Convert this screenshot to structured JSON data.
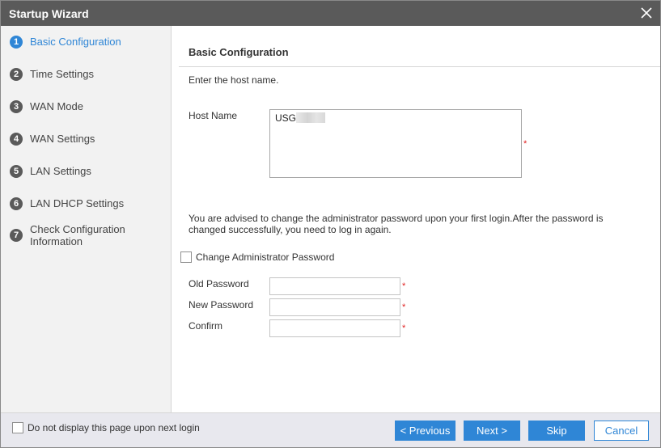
{
  "window": {
    "title": "Startup Wizard",
    "close_icon": "close-icon"
  },
  "sidebar": {
    "steps": [
      {
        "num": "1",
        "label": "Basic Configuration",
        "active": true
      },
      {
        "num": "2",
        "label": "Time Settings"
      },
      {
        "num": "3",
        "label": "WAN Mode"
      },
      {
        "num": "4",
        "label": "WAN Settings"
      },
      {
        "num": "5",
        "label": "LAN Settings"
      },
      {
        "num": "6",
        "label": "LAN DHCP Settings"
      },
      {
        "num": "7",
        "label": "Check Configuration Information"
      }
    ]
  },
  "main": {
    "section_title": "Basic Configuration",
    "intro": "Enter the host name.",
    "host_name": {
      "label": "Host Name",
      "value": "USG"
    },
    "required_mark": "*",
    "advice": "You are advised to change the administrator password upon your first login.After the password is changed successfully, you need to log in again.",
    "change_password": {
      "label": "Change Administrator Password",
      "checked": false
    },
    "old_password": {
      "label": "Old Password",
      "value": ""
    },
    "new_password": {
      "label": "New Password",
      "value": ""
    },
    "confirm": {
      "label": "Confirm",
      "value": ""
    }
  },
  "footer": {
    "dont_show_label": "Do not display this page upon next login",
    "previous": "< Previous",
    "next": "Next >",
    "skip": "Skip",
    "cancel": "Cancel"
  },
  "colors": {
    "accent": "#2f86d6",
    "titlebar": "#5a5a5a",
    "required": "#e02020"
  }
}
